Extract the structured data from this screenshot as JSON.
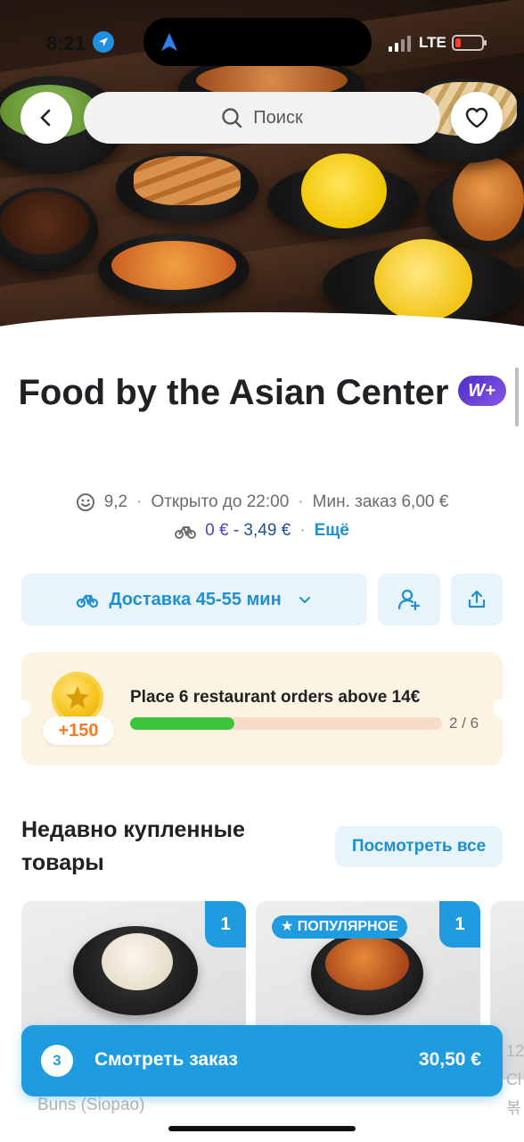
{
  "status_bar": {
    "time": "8:21",
    "network": "LTE"
  },
  "search": {
    "placeholder": "Поиск"
  },
  "restaurant": {
    "name": "Food by the Asian Center",
    "badge": "W+",
    "rating": "9,2",
    "open_until": "Открыто до 22:00",
    "min_order": "Мин. заказ 6,00 €",
    "delivery_fee_from": "0 €",
    "delivery_fee_to": "- 3,49 €",
    "more_link": "Ещё"
  },
  "delivery_selector": {
    "label": "Доставка 45-55 мин"
  },
  "challenge": {
    "reward": "+150",
    "title": "Place 6 restaurant orders above 14€",
    "progress": 0.333,
    "progress_text": "2 / 6"
  },
  "recent": {
    "title": "Недавно купленные товары",
    "see_all": "Посмотреть все",
    "items": [
      {
        "quantity": "1",
        "name": "Buns (Siopao)"
      },
      {
        "quantity": "1",
        "badge": "ПОПУЛЯРНОЕ"
      }
    ],
    "edge_partial_text": [
      "12",
      "Cl",
      "볶"
    ]
  },
  "cart": {
    "count": "3",
    "label": "Смотреть заказ",
    "total": "30,50 €"
  },
  "colors": {
    "accent": "#1f9be0",
    "accent_text": "#1f8fcf",
    "plus_purple": "#5b3cc4",
    "progress_green": "#3cc43a",
    "challenge_bg": "#fdf3e3"
  }
}
